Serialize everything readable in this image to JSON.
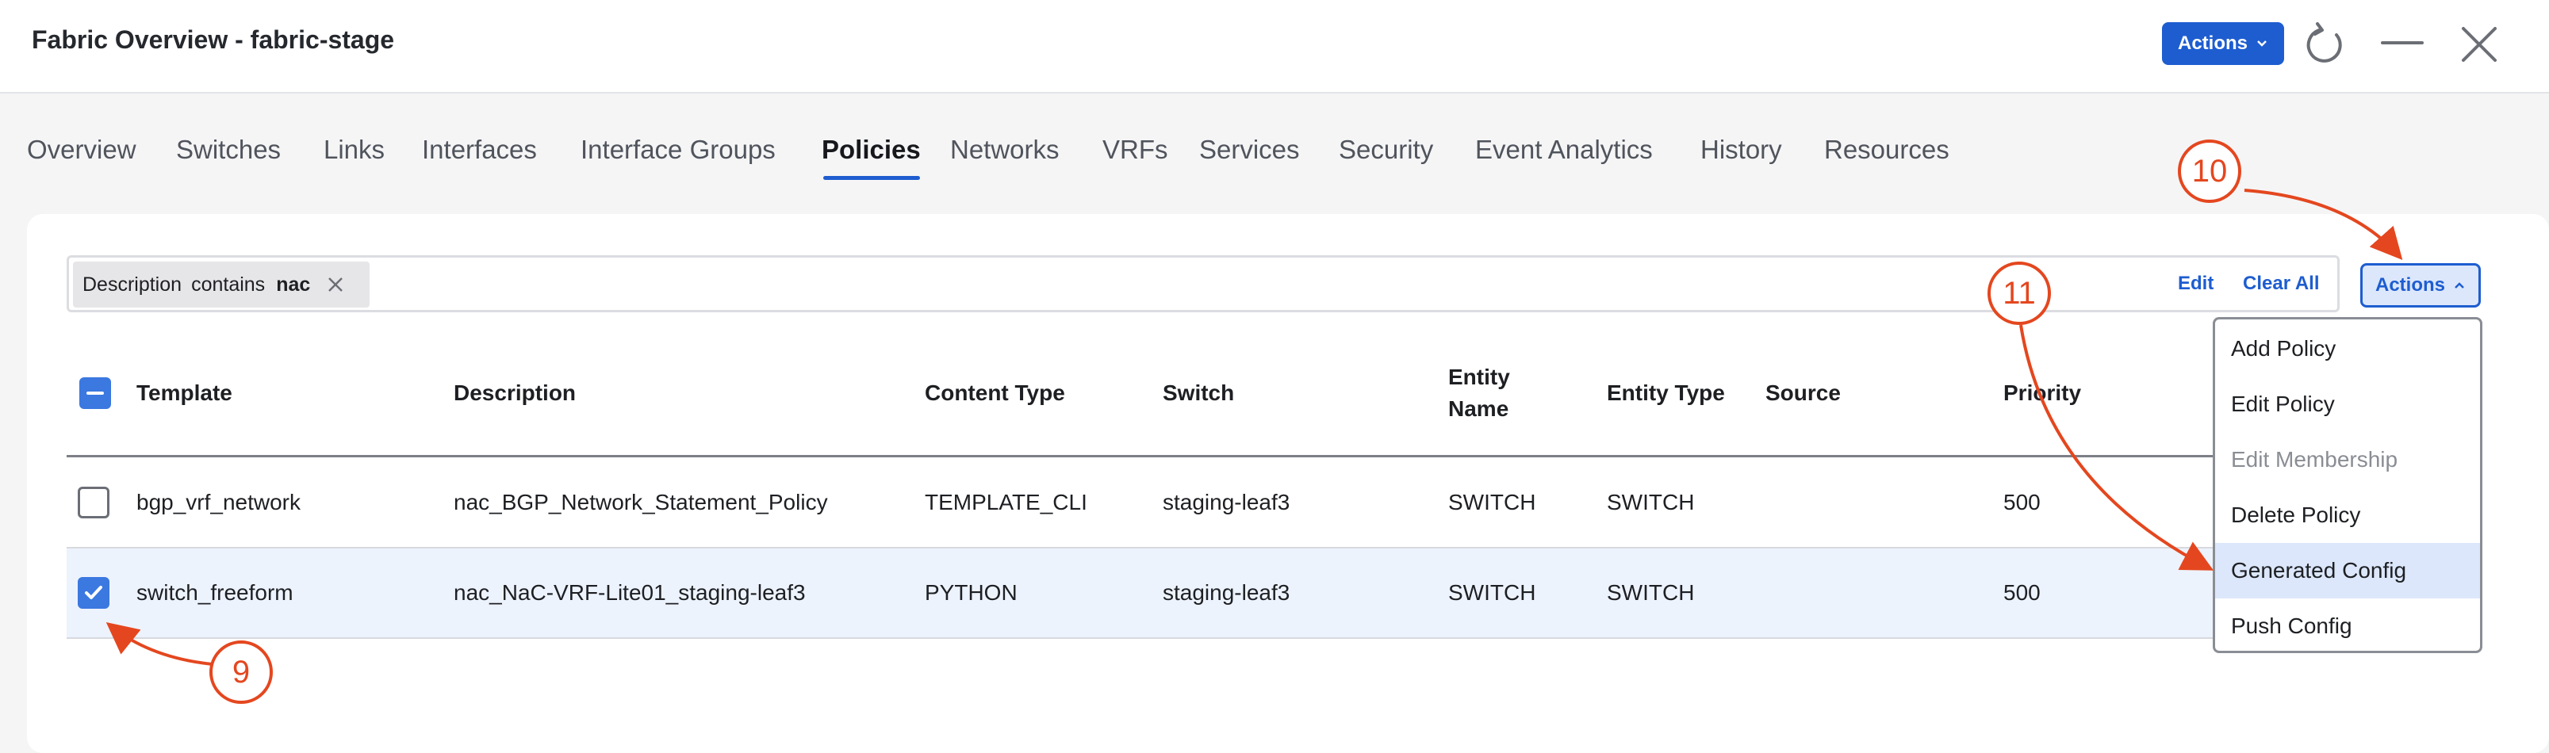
{
  "header": {
    "title": "Fabric Overview - fabric-stage",
    "actions_label": "Actions"
  },
  "tabs": [
    {
      "label": "Overview"
    },
    {
      "label": "Switches"
    },
    {
      "label": "Links"
    },
    {
      "label": "Interfaces"
    },
    {
      "label": "Interface Groups"
    },
    {
      "label": "Policies",
      "active": true
    },
    {
      "label": "Networks"
    },
    {
      "label": "VRFs"
    },
    {
      "label": "Services"
    },
    {
      "label": "Security"
    },
    {
      "label": "Event Analytics"
    },
    {
      "label": "History"
    },
    {
      "label": "Resources"
    }
  ],
  "filter": {
    "field": "Description",
    "operator": "contains",
    "value": "nac",
    "edit_label": "Edit",
    "clear_label": "Clear All"
  },
  "table_actions_label": "Actions",
  "table": {
    "columns": [
      "Template",
      "Description",
      "Content Type",
      "Switch",
      "Entity Name",
      "Entity Type",
      "Source",
      "Priority"
    ],
    "rows": [
      {
        "template": "bgp_vrf_network",
        "description": "nac_BGP_Network_Statement_Policy",
        "content_type": "TEMPLATE_CLI",
        "switch": "staging-leaf3",
        "entity_name": "SWITCH",
        "entity_type": "SWITCH",
        "source": "",
        "priority": "500",
        "selected": false
      },
      {
        "template": "switch_freeform",
        "description": "nac_NaC-VRF-Lite01_staging-leaf3",
        "content_type": "PYTHON",
        "switch": "staging-leaf3",
        "entity_name": "SWITCH",
        "entity_type": "SWITCH",
        "source": "",
        "priority": "500",
        "selected": true
      }
    ]
  },
  "actions_menu": [
    {
      "label": "Add Policy",
      "disabled": false
    },
    {
      "label": "Edit Policy",
      "disabled": false
    },
    {
      "label": "Edit Membership",
      "disabled": true
    },
    {
      "label": "Delete Policy",
      "disabled": false
    },
    {
      "label": "Generated Config",
      "disabled": false,
      "highlighted": true
    },
    {
      "label": "Push Config",
      "disabled": false
    }
  ],
  "callouts": [
    "9",
    "10",
    "11"
  ],
  "colors": {
    "accent": "#1e5dd0",
    "callout": "#e4471f",
    "selected_row": "#edf3fd"
  },
  "icons": [
    "refresh-icon",
    "minimize-icon",
    "close-icon",
    "chevron-down-icon",
    "chevron-up-icon",
    "remove-filter-icon",
    "checkbox-indeterminate-icon",
    "checkbox-checked-icon"
  ]
}
